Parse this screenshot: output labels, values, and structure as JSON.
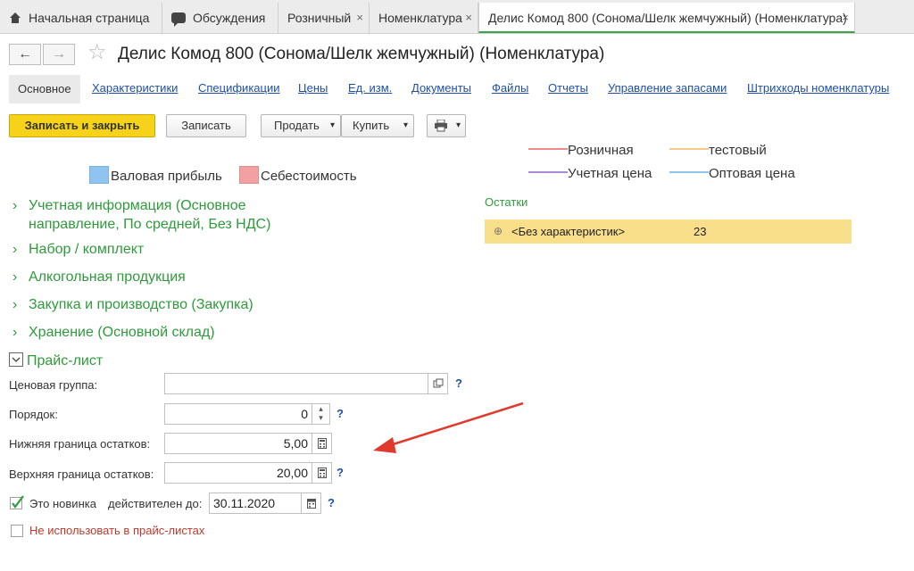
{
  "tabs": [
    {
      "label": "Начальная страница",
      "icon": "home-icon"
    },
    {
      "label": "Обсуждения",
      "icon": "chat-icon"
    },
    {
      "label": "Розничный",
      "close": "×"
    },
    {
      "label": "Номенклатура",
      "close": "×"
    },
    {
      "label": "Делис Комод 800 (Сонома/Шелк жемчужный) (Номенклатура)",
      "close": "×"
    }
  ],
  "header": {
    "back": "←",
    "forward": "→",
    "star": "☆",
    "title": "Делис Комод 800 (Сонома/Шелк жемчужный) (Номенклатура)"
  },
  "sections": [
    "Основное",
    "Характеристики",
    "Спецификации",
    "Цены",
    "Ед. изм.",
    "Документы",
    "Файлы",
    "Отчеты",
    "Управление запасами",
    "Штрихкоды номенклатуры"
  ],
  "toolbar": {
    "save_close": "Записать и закрыть",
    "save": "Записать",
    "sell": "Продать",
    "buy": "Купить",
    "dropdown_arrow": "▾",
    "print_icon": "printer-icon"
  },
  "legend_left": {
    "gross_profit": "Валовая прибыль",
    "cost": "Себестоимость",
    "gross_profit_color": "#8fc4f0",
    "cost_color": "#f2a0a0"
  },
  "legend_right": [
    {
      "label": "Розничная",
      "color": "#f08a8a"
    },
    {
      "label": "тестовый",
      "color": "#f5c98a"
    },
    {
      "label": "Учетная цена",
      "color": "#a98ad6"
    },
    {
      "label": "Оптовая цена",
      "color": "#8cc6ef"
    }
  ],
  "groups": {
    "accounting_line1": "Учетная информация (Основное",
    "accounting_line2": "направление, По средней, Без НДС)",
    "set": "Набор / комплект",
    "alcohol": "Алкогольная продукция",
    "purchase": "Закупка и производство (Закупка)",
    "storage": "Хранение (Основной склад)",
    "pricelist": "Прайс-лист",
    "chevron_closed": "›",
    "chevron_open": "⌄"
  },
  "stock": {
    "title": "Остатки",
    "expand": "⊕",
    "row_label": "<Без характеристик>",
    "row_value": "23"
  },
  "pricelist_form": {
    "price_group_label": "Ценовая группа:",
    "price_group_value": "",
    "order_label": "Порядок:",
    "order_value": "0",
    "lower_label": "Нижняя граница остатков:",
    "lower_value": "5,00",
    "upper_label": "Верхняя граница остатков:",
    "upper_value": "20,00",
    "new_label": "Это новинка",
    "new_checked": true,
    "valid_until_label": "действителен до:",
    "valid_until_value": "30.11.2020",
    "not_use_label": "Не использовать в прайс-листах",
    "not_use_checked": false,
    "help": "?"
  },
  "colors": {
    "accent_green": "#2f9a3c",
    "link_blue": "#1f4fa6",
    "primary_yellow": "#f7d21a",
    "stock_row_bg": "#f9df8a",
    "arrow_red": "#e03a2f",
    "warning_red": "#c0392b"
  }
}
